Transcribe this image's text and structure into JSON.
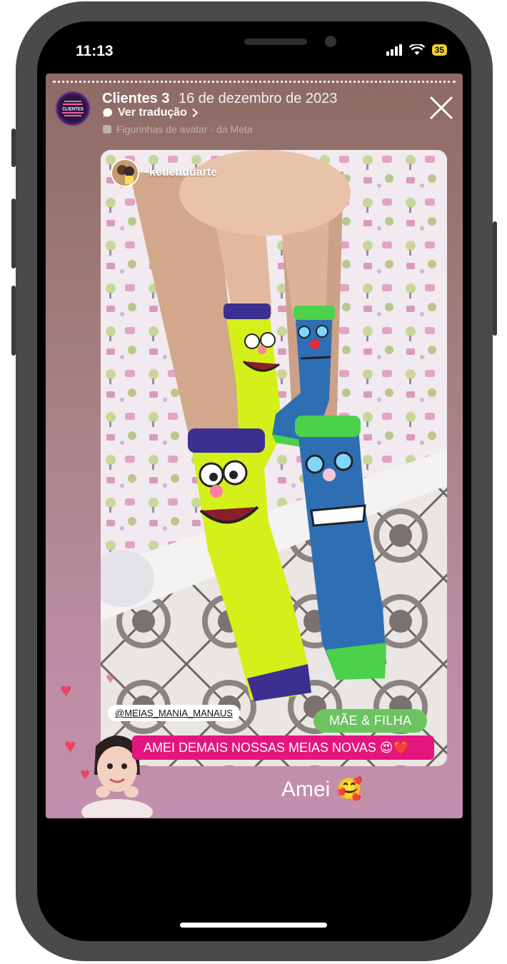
{
  "status_bar": {
    "time": "11:13",
    "battery": "35"
  },
  "story": {
    "account_name": "Clientes 3",
    "date": "16 de dezembro de 2023",
    "translate_label": "Ver tradução",
    "meta_label": "Figurinhas de avatar · da Meta",
    "avatar_logo_text": "CLIENTES",
    "post": {
      "username": "ketlenduarte",
      "tag_mention": "@MEIAS_MANIA_MANAUS",
      "tag_badge": "MÃE & FILHA",
      "caption": "AMEI DEMAIS NOSSAS MEIAS NOVAS 😍❤️"
    },
    "reply_text": "Amei 🥰"
  },
  "colors": {
    "caption_bg": "#e5157e",
    "badge_bg": "#6bc45f",
    "battery": "#f4d12d",
    "sock_yellow": "#d4f01a",
    "sock_blue": "#2e6fb3"
  },
  "icons": [
    "signal-icon",
    "wifi-icon",
    "battery-icon",
    "close-icon",
    "chat-bubble-icon",
    "chevron-right-icon",
    "heart-icon"
  ]
}
